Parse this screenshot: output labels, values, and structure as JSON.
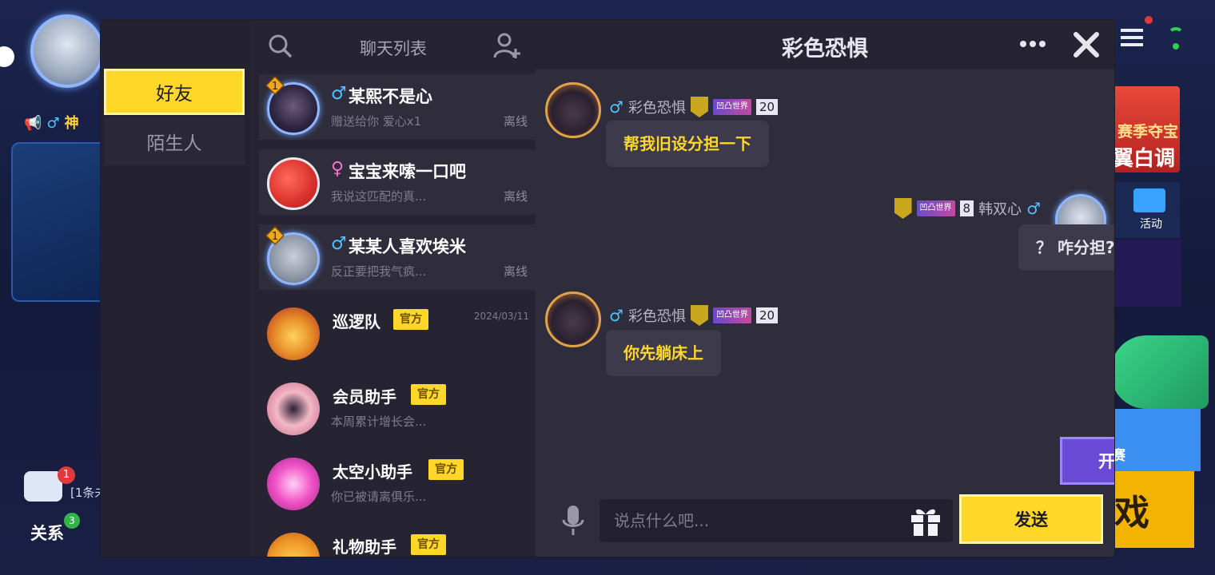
{
  "background": {
    "profile_name": "神",
    "chat_badge": "1",
    "chat_preview": "[1条未",
    "relations_label": "关系",
    "relations_badge": "3",
    "season_line1": "赛季夺宝",
    "season_line2": "翼白调",
    "activity_label": "活动",
    "match_label": "赛",
    "game_label": "戏"
  },
  "tabs": {
    "friends": "好友",
    "strangers": "陌生人"
  },
  "list": {
    "title": "聊天列表",
    "items": [
      {
        "name": "某熙不是心",
        "gender": "♂",
        "subtitle": "赠送给你 爱心x1",
        "status": "离线",
        "rank": "1"
      },
      {
        "name": "宝宝来嗦一口吧",
        "gender": "♀",
        "subtitle": "我说这匹配的真...",
        "status": "离线"
      },
      {
        "name": "某某人喜欢埃米",
        "gender": "♂",
        "subtitle": "反正要把我气疯...",
        "status": "离线",
        "rank": "1"
      },
      {
        "name": "巡逻队",
        "badge": "官方",
        "date": "2024/03/11"
      },
      {
        "name": "会员助手",
        "badge": "官方",
        "subtitle": "本周累计增长会..."
      },
      {
        "name": "太空小助手",
        "badge": "官方",
        "subtitle": "你已被请离俱乐..."
      },
      {
        "name": "礼物助手",
        "badge": "官方"
      }
    ]
  },
  "chat": {
    "title": "彩色恐惧",
    "messages": [
      {
        "sender": "彩色恐惧",
        "gender": "♂",
        "world_tag": "凹凸世界",
        "level": "20",
        "text": "帮我旧设分担一下"
      },
      {
        "sender": "韩双心",
        "gender": "♂",
        "world_tag": "凹凸世界",
        "level": "8",
        "text": "？ 咋分担?"
      },
      {
        "sender": "彩色恐惧",
        "gender": "♂",
        "world_tag": "凹凸世界",
        "level": "20",
        "text": "你先躺床上"
      }
    ],
    "party_button": "开启派对",
    "input_placeholder": "说点什么吧...",
    "send_button": "发送"
  },
  "colors": {
    "accent_yellow": "#ffd728",
    "party_purple": "#6a4bd6",
    "male_blue": "#4cc3ff",
    "female_pink": "#ff6fd1"
  }
}
